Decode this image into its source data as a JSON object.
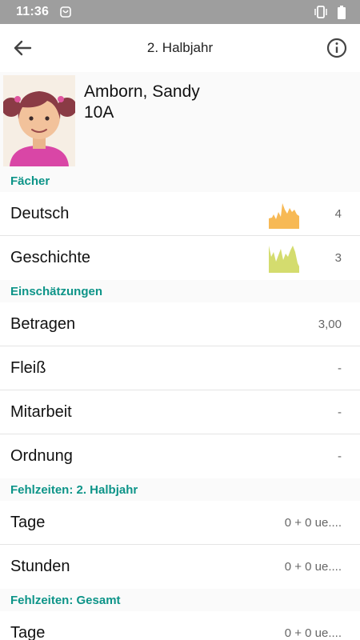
{
  "status_bar": {
    "time": "11:36"
  },
  "header": {
    "title": "2. Halbjahr"
  },
  "student": {
    "name": "Amborn, Sandy",
    "class": "10A"
  },
  "sections": {
    "subjects": {
      "title": "Fächer",
      "items": [
        {
          "label": "Deutsch",
          "value": "4",
          "spark_color": "#f7b955"
        },
        {
          "label": "Geschichte",
          "value": "3",
          "spark_color": "#d4dc6e"
        }
      ]
    },
    "assessments": {
      "title": "Einschätzungen",
      "items": [
        {
          "label": "Betragen",
          "value": "3,00"
        },
        {
          "label": "Fleiß",
          "value": "-"
        },
        {
          "label": "Mitarbeit",
          "value": "-"
        },
        {
          "label": "Ordnung",
          "value": "-"
        }
      ]
    },
    "absence_term": {
      "title": "Fehlzeiten: 2. Halbjahr",
      "items": [
        {
          "label": "Tage",
          "value": "0 + 0 ue...."
        },
        {
          "label": "Stunden",
          "value": "0 + 0 ue...."
        }
      ]
    },
    "absence_total": {
      "title": "Fehlzeiten: Gesamt",
      "items": [
        {
          "label": "Tage",
          "value": "0 + 0 ue...."
        }
      ]
    }
  },
  "colors": {
    "accent": "#0d9488",
    "status_bar": "#9e9e9e"
  }
}
